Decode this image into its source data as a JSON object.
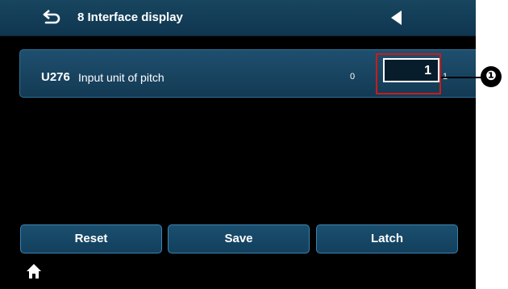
{
  "header": {
    "title": "8 Interface display"
  },
  "icons": {
    "back": "back-arrow-icon",
    "previous": "triangle-left-icon",
    "home": "home-icon"
  },
  "parameter": {
    "code": "U276",
    "description": "Input unit of pitch",
    "min": "0",
    "value": "1",
    "max": "1"
  },
  "callout": {
    "marker": "❶"
  },
  "buttons": {
    "reset": "Reset",
    "save": "Save",
    "latch": "Latch"
  },
  "colors": {
    "header_bg": "#164560",
    "panel_bg": "#1a4a68",
    "accent_border": "#3b82b0",
    "callout_red": "#cc1a1a",
    "screen_bg": "#000000"
  }
}
